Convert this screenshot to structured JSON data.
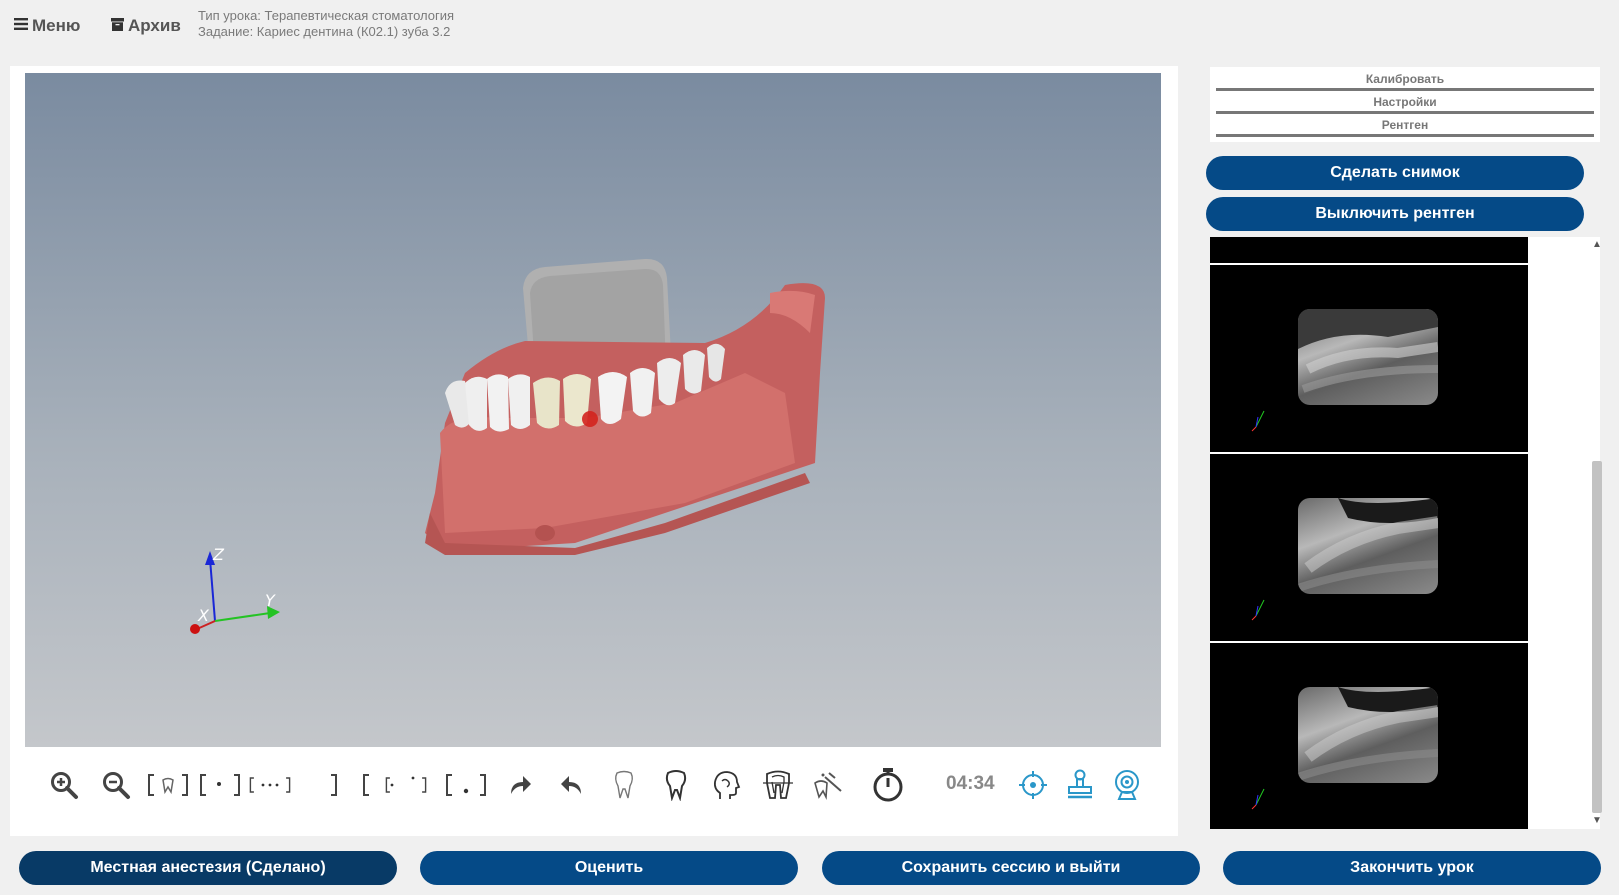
{
  "header": {
    "menu_label": "Меню",
    "archive_label": "Архив",
    "lesson_type": "Тип урока: Терапевтическая стоматология",
    "task": "Задание: Кариес дентина (К02.1) зуба 3.2"
  },
  "viewport": {
    "axis_z": "Z",
    "axis_x": "X",
    "axis_y": "Y"
  },
  "toolbar": {
    "timer": "04:34",
    "tools": [
      {
        "name": "zoom-in-icon"
      },
      {
        "name": "zoom-out-icon"
      },
      {
        "name": "view-tooth-frame-icon"
      },
      {
        "name": "view-frame-dot-left-icon"
      },
      {
        "name": "view-frame-dots-icon"
      },
      {
        "name": "view-frame-bracket-icon"
      },
      {
        "name": "view-frame-dot-corner-icon"
      },
      {
        "name": "view-frame-dot-bottom-icon"
      },
      {
        "name": "redo-icon"
      },
      {
        "name": "undo-icon"
      },
      {
        "name": "tooth-outline-icon"
      },
      {
        "name": "tooth-icon"
      },
      {
        "name": "head-profile-icon"
      },
      {
        "name": "tooth-cross-section-icon"
      },
      {
        "name": "tooth-drill-icon"
      },
      {
        "name": "stopwatch-icon"
      },
      {
        "name": "target-icon"
      },
      {
        "name": "stamp-icon"
      },
      {
        "name": "webcam-icon"
      }
    ]
  },
  "settings": {
    "calibrate": "Калибровать",
    "settings": "Настройки",
    "xray": "Рентген"
  },
  "actions": {
    "take_shot": "Сделать снимок",
    "turn_off_xray": "Выключить  рентген"
  },
  "footer": {
    "anesthesia": "Местная анестезия (Сделано)",
    "evaluate": "Оценить",
    "save_exit": "Сохранить сессию и выйти",
    "finish": "Закончить урок"
  },
  "colors": {
    "primary_button": "#054a87",
    "anesthesia_button": "#083a66",
    "icon_accent": "#2a97c9"
  }
}
